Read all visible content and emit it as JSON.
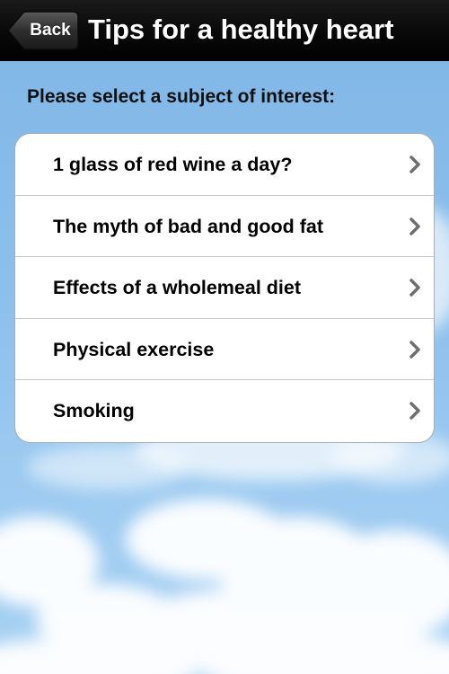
{
  "nav": {
    "back_label": "Back",
    "title": "Tips for a healthy heart"
  },
  "prompt": "Please select a subject of interest:",
  "items": [
    {
      "label": "1 glass of red wine a day?",
      "icon": "chevron-right-icon"
    },
    {
      "label": "The myth of bad and good fat",
      "icon": "chevron-right-icon"
    },
    {
      "label": "Effects of a wholemeal diet",
      "icon": "chevron-right-icon"
    },
    {
      "label": "Physical exercise",
      "icon": "chevron-right-icon"
    },
    {
      "label": "Smoking",
      "icon": "chevron-right-icon"
    }
  ],
  "colors": {
    "navbar": "#000000",
    "sky": "#8dc0ec",
    "list_background": "#ffffff",
    "chevron": "#6e6e6e"
  }
}
